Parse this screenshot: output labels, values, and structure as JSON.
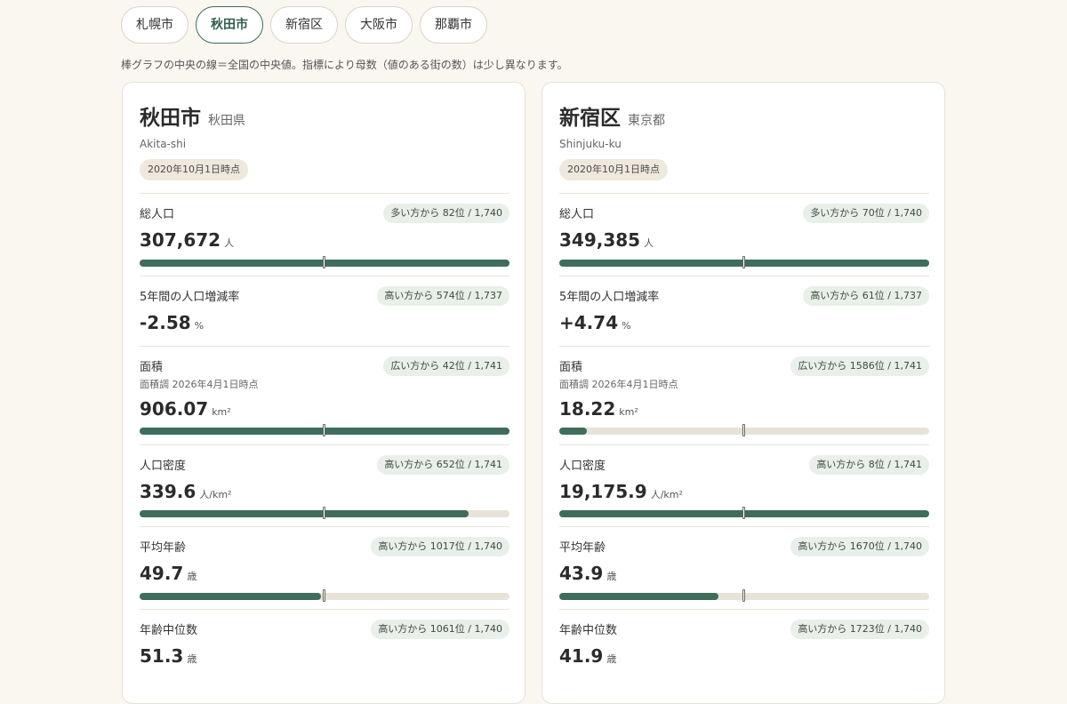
{
  "tabs": [
    {
      "label": "札幌市",
      "active": false
    },
    {
      "label": "秋田市",
      "active": true
    },
    {
      "label": "新宿区",
      "active": false
    },
    {
      "label": "大阪市",
      "active": false
    },
    {
      "label": "那覇市",
      "active": false
    }
  ],
  "note": "棒グラフの中央の線＝全国の中央値。指標により母数（値のある街の数）は少し異なります。",
  "colors": {
    "accent": "#3e6d5c",
    "bar_track": "#e7e3d8",
    "background": "#faf7f1"
  },
  "cards": [
    {
      "name": "秋田市",
      "prefecture": "秋田県",
      "romaji": "Akita-shi",
      "date": "2020年10月1日時点",
      "metrics": [
        {
          "label": "総人口",
          "sublabel": "",
          "rank": "多い方から 82位 / 1,740",
          "value": "307,672",
          "unit": "人",
          "fill": 1.0
        },
        {
          "label": "5年間の人口増減率",
          "sublabel": "",
          "rank": "高い方から 574位 / 1,737",
          "value": "-2.58",
          "unit": "%",
          "fill": null
        },
        {
          "label": "面積",
          "sublabel": "面積調 2026年4月1日時点",
          "rank": "広い方から 42位 / 1,741",
          "value": "906.07",
          "unit": "km²",
          "fill": 1.0
        },
        {
          "label": "人口密度",
          "sublabel": "",
          "rank": "高い方から 652位 / 1,741",
          "value": "339.6",
          "unit": "人/km²",
          "fill": 0.89
        },
        {
          "label": "平均年齢",
          "sublabel": "",
          "rank": "高い方から 1017位 / 1,740",
          "value": "49.7",
          "unit": "歳",
          "fill": 0.49
        },
        {
          "label": "年齢中位数",
          "sublabel": "",
          "rank": "高い方から 1061位 / 1,740",
          "value": "51.3",
          "unit": "歳",
          "fill": null
        }
      ]
    },
    {
      "name": "新宿区",
      "prefecture": "東京都",
      "romaji": "Shinjuku-ku",
      "date": "2020年10月1日時点",
      "metrics": [
        {
          "label": "総人口",
          "sublabel": "",
          "rank": "多い方から 70位 / 1,740",
          "value": "349,385",
          "unit": "人",
          "fill": 1.0
        },
        {
          "label": "5年間の人口増減率",
          "sublabel": "",
          "rank": "高い方から 61位 / 1,737",
          "value": "+4.74",
          "unit": "%",
          "fill": null
        },
        {
          "label": "面積",
          "sublabel": "面積調 2026年4月1日時点",
          "rank": "広い方から 1586位 / 1,741",
          "value": "18.22",
          "unit": "km²",
          "fill": 0.075
        },
        {
          "label": "人口密度",
          "sublabel": "",
          "rank": "高い方から 8位 / 1,741",
          "value": "19,175.9",
          "unit": "人/km²",
          "fill": 1.0
        },
        {
          "label": "平均年齢",
          "sublabel": "",
          "rank": "高い方から 1670位 / 1,740",
          "value": "43.9",
          "unit": "歳",
          "fill": 0.43
        },
        {
          "label": "年齢中位数",
          "sublabel": "",
          "rank": "高い方から 1723位 / 1,740",
          "value": "41.9",
          "unit": "歳",
          "fill": null
        }
      ]
    }
  ]
}
